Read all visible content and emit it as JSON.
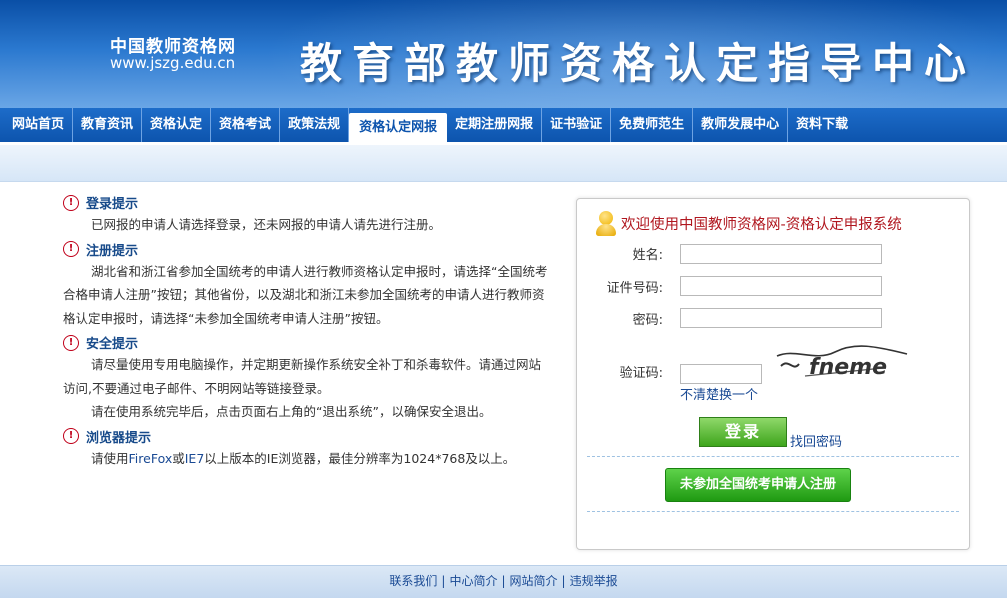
{
  "header": {
    "site_name": "中国教师资格网",
    "site_url": "www.jszg.edu.cn",
    "center_title": "教育部教师资格认定指导中心"
  },
  "nav": {
    "items": [
      "网站首页",
      "教育资讯",
      "资格认定",
      "资格考试",
      "政策法规",
      "资格认定网报",
      "定期注册网报",
      "证书验证",
      "免费师范生",
      "教师发展中心",
      "资料下载"
    ],
    "active": "资格认定网报"
  },
  "tips": [
    {
      "title": "登录提示",
      "paragraphs": [
        "已网报的申请人请选择登录，还未网报的申请人请先进行注册。"
      ]
    },
    {
      "title": "注册提示",
      "paragraphs": [
        "湖北省和浙江省参加全国统考的申请人进行教师资格认定申报时，请选择“全国统考合格申请人注册”按钮；其他省份，以及湖北和浙江未参加全国统考的申请人进行教师资格认定申报时，请选择“未参加全国统考申请人注册”按钮。"
      ]
    },
    {
      "title": "安全提示",
      "paragraphs": [
        "请尽量使用专用电脑操作，并定期更新操作系统安全补丁和杀毒软件。请通过网站访问,不要通过电子邮件、不明网站等链接登录。",
        "请在使用系统完毕后，点击页面右上角的“退出系统”，以确保安全退出。"
      ]
    },
    {
      "title": "浏览器提示",
      "prefix": "请使用",
      "browser1": "FireFox",
      "mid": "或",
      "browser2": "IE7",
      "suffix": "以上版本的IE浏览器，最佳分辨率为1024*768及以上。"
    }
  ],
  "login": {
    "welcome": "欢迎使用中国教师资格网-资格认定申报系统",
    "name_label": "姓名:",
    "id_label": "证件号码:",
    "password_label": "密码:",
    "captcha_label": "验证码:",
    "captcha_text": "fneme",
    "refresh_link": "不清楚换一个",
    "login_button": "登录",
    "forgot_link": "找回密码",
    "register_button": "未参加全国统考申请人注册"
  },
  "footer": {
    "links": [
      "联系我们",
      "中心简介",
      "网站简介",
      "违规举报"
    ]
  }
}
